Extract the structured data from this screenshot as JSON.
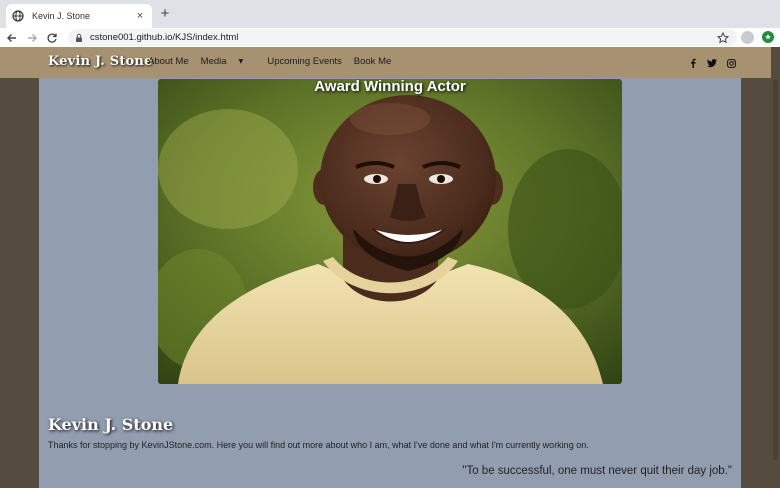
{
  "browser": {
    "tab_title": "Kevin J. Stone",
    "tab_close": "×",
    "new_tab": "+",
    "url": "cstone001.github.io/KJS/index.html"
  },
  "site": {
    "brand": "Kevin J. Stone",
    "nav": {
      "about": "About Me",
      "media": "Media",
      "media_caret": "▾",
      "events": "Upcoming Events",
      "book": "Book Me"
    },
    "social": [
      "facebook-icon",
      "twitter-icon",
      "instagram-icon"
    ],
    "colors": {
      "navbar": "#a69271",
      "page_bg": "#564b3f",
      "content_bg": "#929eb0"
    }
  },
  "hero": {
    "caption": "Award Winning Actor"
  },
  "content": {
    "heading": "Kevin J. Stone",
    "intro": "Thanks for stopping by KevinJStone.com. Here you will find out more about who I am, what I've done and what I'm currently working on.",
    "quote": "\"To be successful, one must never quit their day job.\""
  }
}
